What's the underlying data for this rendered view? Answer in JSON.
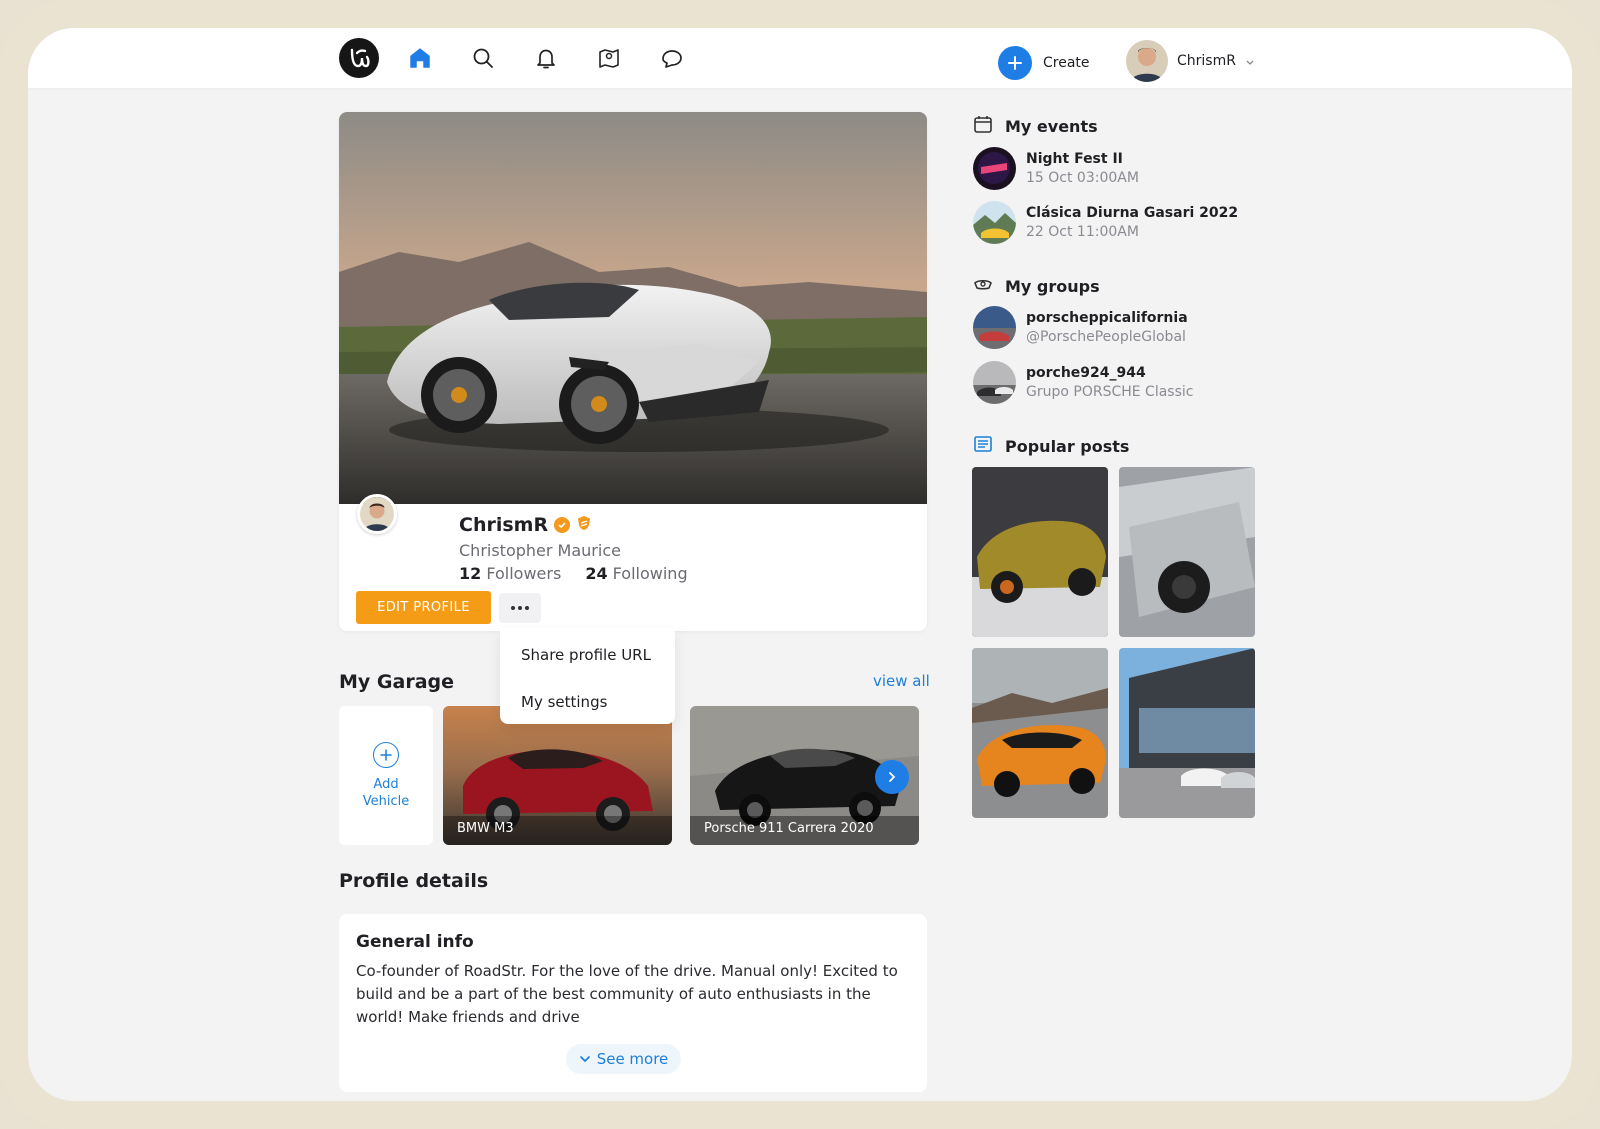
{
  "nav": {
    "logo_icon": "roadstr-logo",
    "icons": [
      "home-icon",
      "search-icon",
      "bell-icon",
      "map-icon",
      "chat-icon"
    ],
    "create_label": "Create",
    "user_name": "ChrismR",
    "accent": "#1f7de6"
  },
  "profile": {
    "username": "ChrismR",
    "full_name": "Christopher Maurice",
    "followers_count": "12",
    "followers_label": "Followers",
    "following_count": "24",
    "following_label": "Following",
    "edit_label": "EDIT PROFILE",
    "edit_color": "#f59c16"
  },
  "menu": {
    "share": "Share profile URL",
    "settings": "My settings"
  },
  "garage": {
    "title": "My Garage",
    "view_all": "view all",
    "add_label": "Add Vehicle",
    "vehicles": [
      {
        "label": "BMW M3"
      },
      {
        "label": "Porsche 911 Carrera 2020"
      }
    ]
  },
  "details": {
    "title": "Profile details",
    "general_title": "General info",
    "general_text": "Co-founder of RoadStr. For the love of the drive. Manual only! Excited to build and be a part of the best community of auto enthusiasts in the world! Make friends and drive",
    "see_more": "See more"
  },
  "sidebar": {
    "events_title": "My events",
    "events": [
      {
        "name": "Night Fest II",
        "date": "15 Oct 03:00AM"
      },
      {
        "name": "Clásica Diurna Gasari 2022",
        "date": "22 Oct 11:00AM"
      }
    ],
    "groups_title": "My groups",
    "groups": [
      {
        "name": "porscheppicalifornia",
        "handle": "@PorschePeopleGlobal"
      },
      {
        "name": "porche924_944",
        "handle": "Grupo PORSCHE Classic"
      }
    ],
    "posts_title": "Popular posts"
  }
}
